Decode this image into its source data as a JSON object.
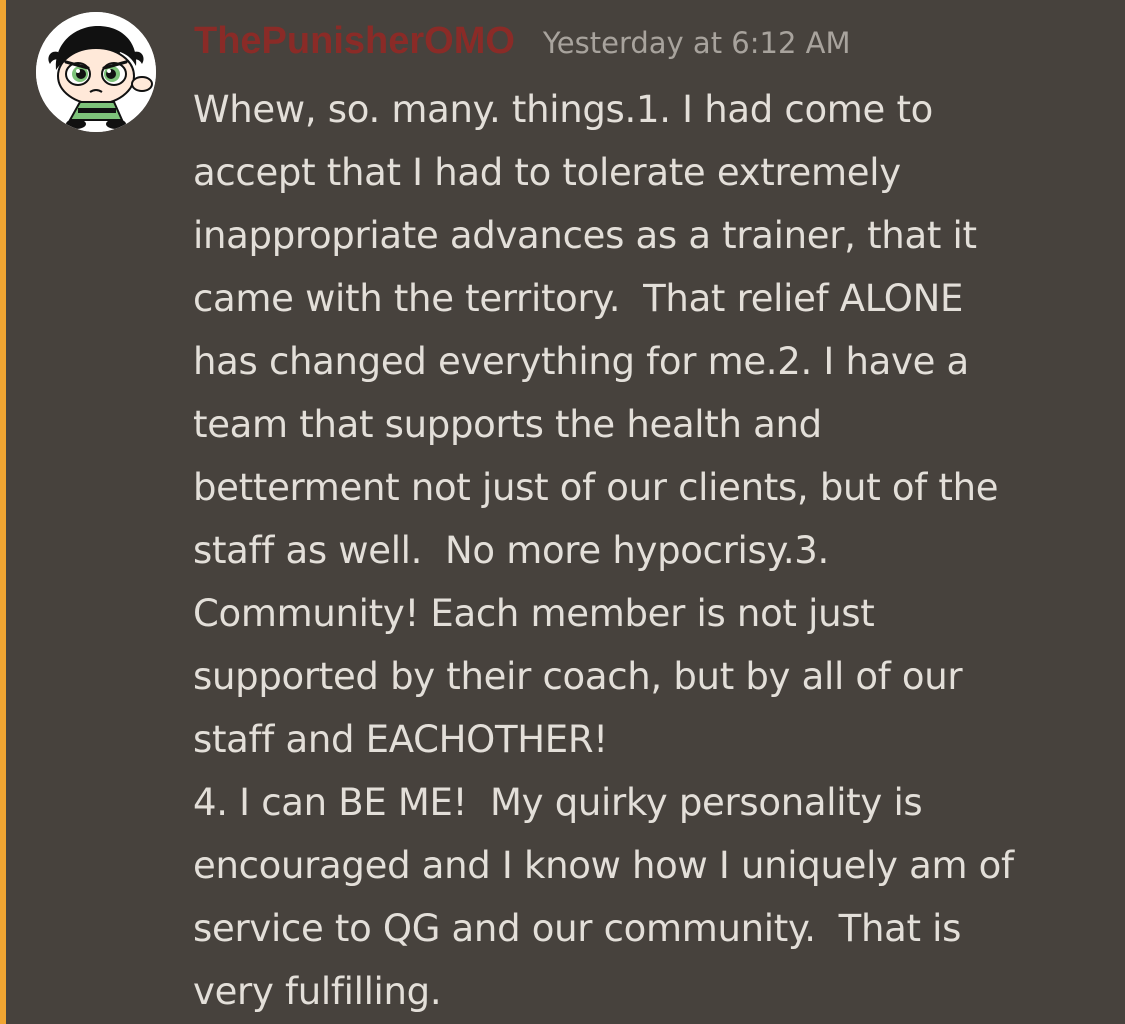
{
  "message": {
    "username": "ThePunisherOMO",
    "timestamp": "Yesterday at 6:12 AM",
    "lines": [
      "Whew, so. many. things.1. I had come to",
      "accept that I had to tolerate extremely",
      "inappropriate advances as a trainer, that it",
      "came with the territory.  That relief ALONE",
      "has changed everything for me.2. I have a",
      "team that supports the health and",
      "betterment not just of our clients, but of the",
      "staff as well.  No more hypocrisy.3.",
      "Community! Each member is not just",
      "supported by their coach, but by all of our",
      "staff and EACHOTHER!",
      "4. I can BE ME!  My quirky personality is",
      "encouraged and I know how I uniquely am of",
      "service to QG and our community.  That is",
      "very fulfilling."
    ]
  },
  "avatar": {
    "icon": "buttercup-avatar-icon"
  },
  "colors": {
    "background": "#47423d",
    "highlight_bar": "#f0a532",
    "username": "#8a2b27",
    "timestamp": "#a8a39d",
    "text": "#e3dfd9"
  }
}
